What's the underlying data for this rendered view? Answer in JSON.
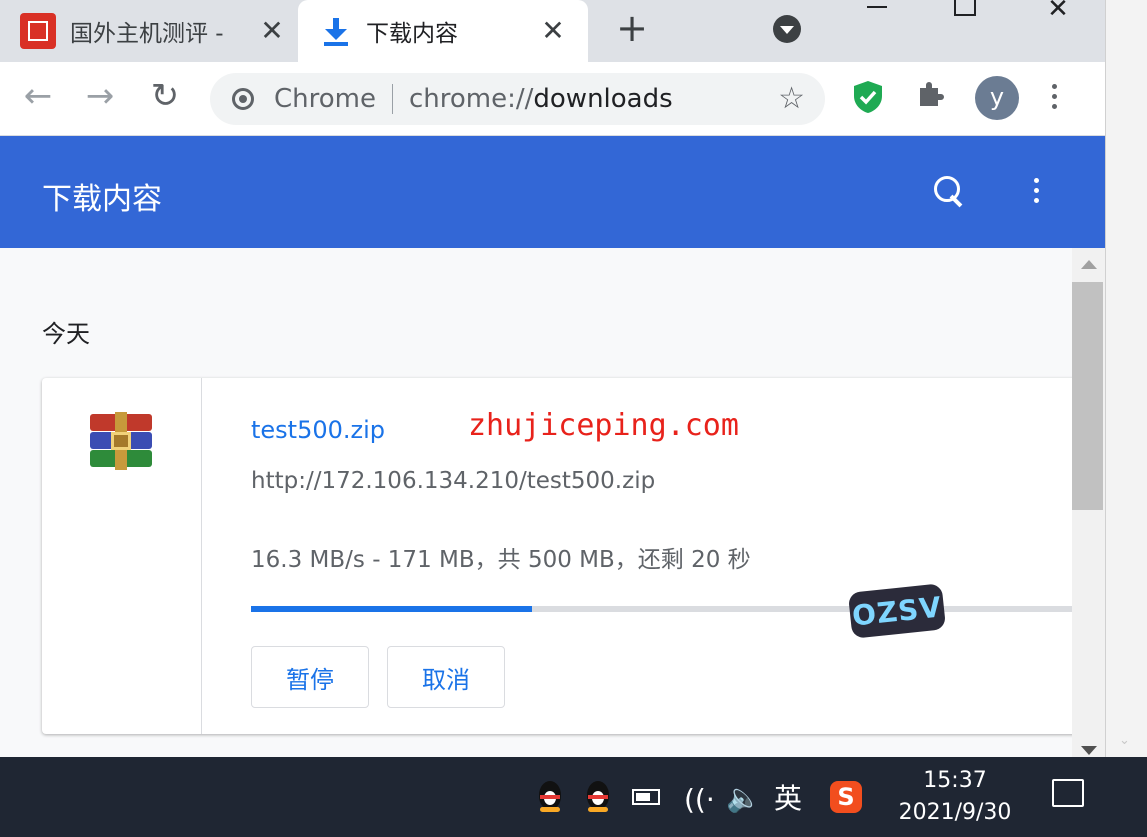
{
  "tabs": [
    {
      "title": "国外主机测评 -"
    },
    {
      "title": "下载内容"
    }
  ],
  "tab_controls": {
    "close_glyph": "✕",
    "new_tab_glyph": "+"
  },
  "toolbar": {
    "back_glyph": "←",
    "forward_glyph": "→",
    "reload_glyph": "↻",
    "omnibox": {
      "site_label": "Chrome",
      "url_scheme": "chrome://",
      "url_host": "downloads"
    },
    "bookmark_glyph": "☆",
    "profile_initial": "y"
  },
  "page": {
    "title": "下载内容",
    "section_label": "今天"
  },
  "download": {
    "file_name": "test500.zip",
    "watermark": "zhujiceping.com",
    "url": "http://172.106.134.210/test500.zip",
    "status": "16.3 MB/s - 171 MB，共 500 MB，还剩 20 秒",
    "progress_fraction": 0.342,
    "pause_label": "暂停",
    "cancel_label": "取消",
    "sticker_text": "OZSV"
  },
  "taskbar": {
    "ime": "英",
    "sogou": "S",
    "time": "15:37",
    "date": "2021/9/30",
    "wifi_glyph": "((·",
    "volume_glyph": "🔈"
  },
  "colors": {
    "header": "#3367d6",
    "accent": "#1a73e8",
    "watermark": "#e8221b"
  },
  "icons": [
    "download-icon",
    "chrome-icon",
    "star-icon",
    "shield-icon",
    "puzzle-icon",
    "search-icon",
    "more-icon",
    "winrar-icon",
    "qq-icon",
    "battery-icon",
    "wifi-icon",
    "volume-icon",
    "notification-icon"
  ]
}
